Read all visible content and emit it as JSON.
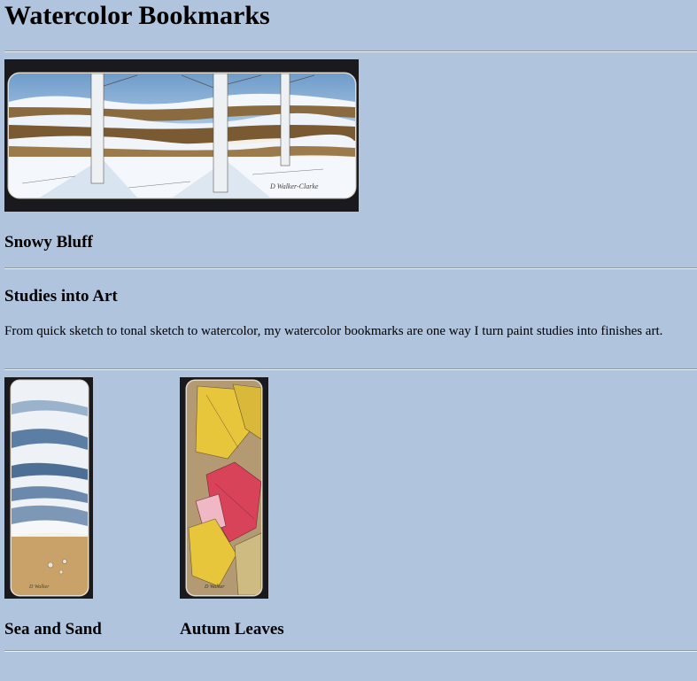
{
  "page": {
    "title": "Watercolor Bookmarks"
  },
  "featured": {
    "caption": "Snowy Bluff",
    "signature": "D Walker-Clarke"
  },
  "section": {
    "heading": "Studies into Art",
    "body": "From quick sketch to tonal sketch to watercolor, my watercolor bookmarks are one way I turn paint studies into finishes art."
  },
  "gallery": {
    "items": [
      {
        "caption": "Sea and Sand",
        "signature": "D Walker"
      },
      {
        "caption": "Autum Leaves",
        "signature": "D Walker"
      }
    ]
  },
  "colors": {
    "background": "#b0c4de",
    "sky": "#7fa8d0",
    "snow": "#f3f6fa",
    "bark": "#8a6a3f",
    "sea": "#4d6f96",
    "sand": "#c9a26a",
    "leaf_yellow": "#e8c63c",
    "leaf_red": "#d9435a"
  }
}
